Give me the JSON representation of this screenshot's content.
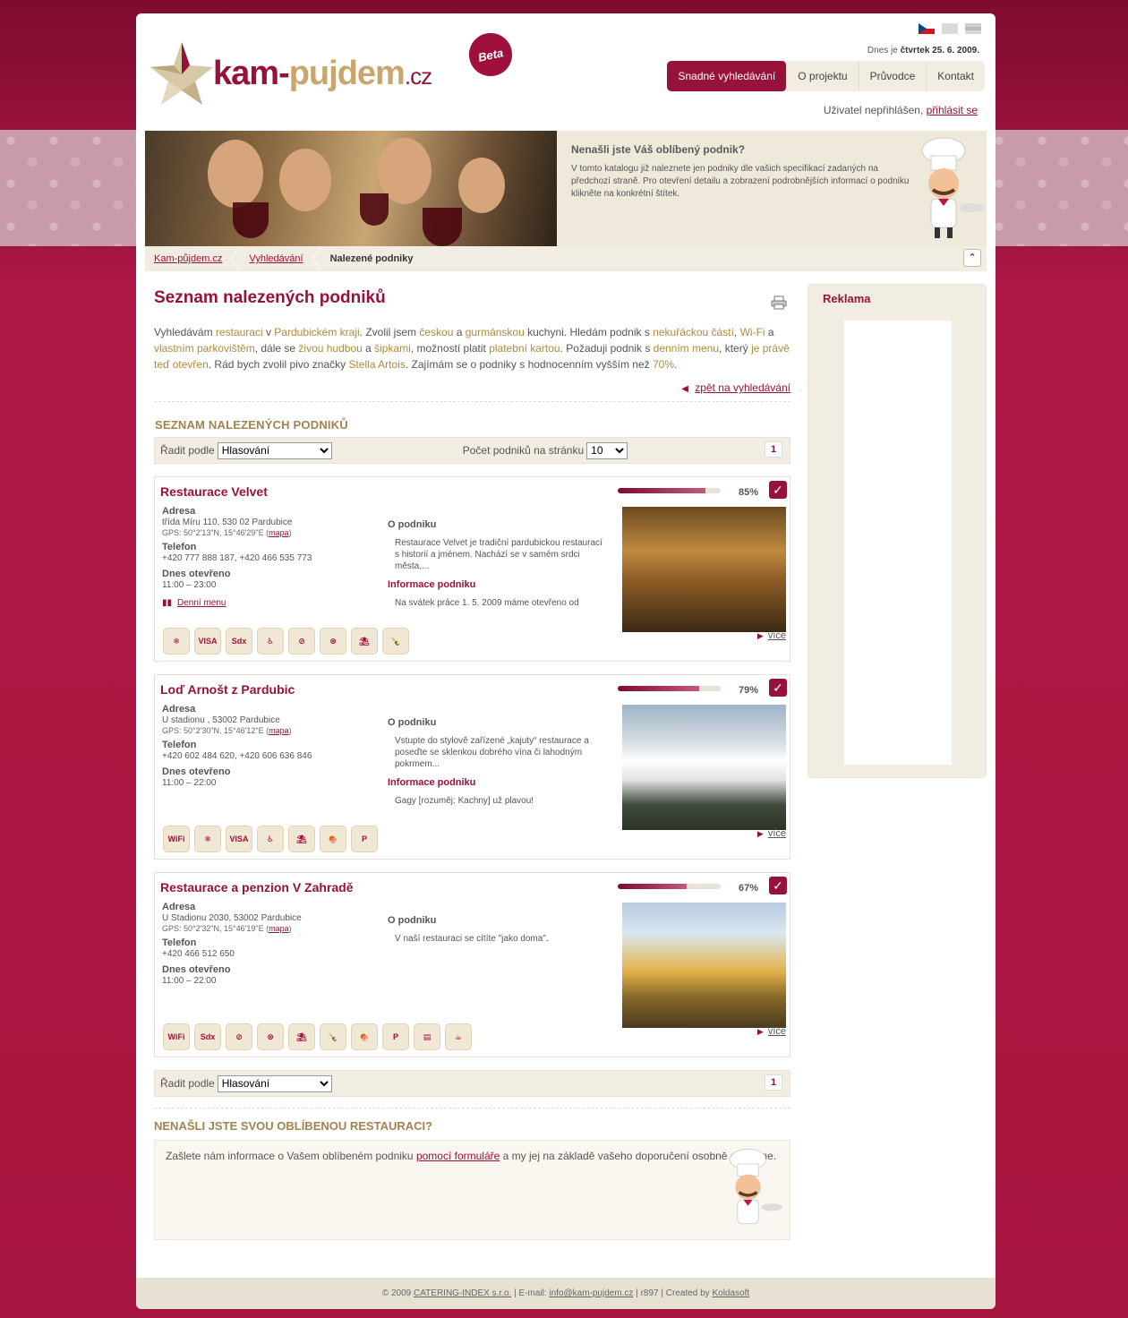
{
  "header": {
    "date_prefix": "Dnes je",
    "date_value": "čtvrtek 25. 6. 2009.",
    "logo": {
      "kam": "kam",
      "dash": "-",
      "pujdem": "pujdem",
      "cz": ".cz",
      "beta": "Beta"
    },
    "user_status": "Uživatel nepřihlášen,",
    "login_label": "přihlásit se"
  },
  "nav": {
    "items": [
      "Snadné vyhledávání",
      "O projektu",
      "Průvodce",
      "Kontakt"
    ],
    "active_index": 0
  },
  "banner": {
    "title": "Nenašli jste Váš oblíbený podnik?",
    "body": "V tomto katalogu již naleznete jen podniky dle vašich specifikací zadaných na předchozí straně. Pro otevření detailu a zobrazení podrobnějších informací o podniku klikněte na konkrétní štítek."
  },
  "breadcrumb": [
    "Kam-půjdem.cz",
    "Vyhledávání",
    "Nalezené podniky"
  ],
  "main": {
    "title": "Seznam nalezených podniků",
    "summary_parts": [
      {
        "t": "Vyhledávám ",
        "h": false
      },
      {
        "t": "restauraci",
        "h": true
      },
      {
        "t": " v ",
        "h": false
      },
      {
        "t": "Pardubickém kraji",
        "h": true
      },
      {
        "t": ". Zvolil jsem ",
        "h": false
      },
      {
        "t": "českou",
        "h": true
      },
      {
        "t": " a ",
        "h": false
      },
      {
        "t": "gurmánskou",
        "h": true
      },
      {
        "t": " kuchyni. Hledám podnik s ",
        "h": false
      },
      {
        "t": "nekuřáckou částí",
        "h": true
      },
      {
        "t": ", ",
        "h": false
      },
      {
        "t": "Wi-Fi",
        "h": true
      },
      {
        "t": " a ",
        "h": false
      },
      {
        "t": "vlastním parkovištěm",
        "h": true
      },
      {
        "t": ", dále se ",
        "h": false
      },
      {
        "t": "živou hudbou",
        "h": true
      },
      {
        "t": " a ",
        "h": false
      },
      {
        "t": "šipkami",
        "h": true
      },
      {
        "t": ", možností platit ",
        "h": false
      },
      {
        "t": "platební kartou",
        "h": true
      },
      {
        "t": ". Požaduji podnik s ",
        "h": false
      },
      {
        "t": "denním menu",
        "h": true
      },
      {
        "t": ", který ",
        "h": false
      },
      {
        "t": "je právě teď otevřen",
        "h": true
      },
      {
        "t": ". Rád bych zvolil pivo značky ",
        "h": false
      },
      {
        "t": "Stella Artois",
        "h": true
      },
      {
        "t": ". Zajímám se o podniky s hodnocenním vyšším než ",
        "h": false
      },
      {
        "t": "70%",
        "h": true
      },
      {
        "t": ".",
        "h": false
      }
    ],
    "back_link": "zpět na vyhledávání",
    "list_heading": "SEZNAM NALEZENÝCH PODNIKŮ",
    "sort_label": "Řadit podle",
    "sort_value": "Hlasování",
    "per_page_label": "Počet podniků na stránku",
    "per_page_value": "10",
    "page_number": "1",
    "labels": {
      "address": "Adresa",
      "phone": "Telefon",
      "open_today": "Dnes otevřeno",
      "about": "O podniku",
      "info": "Informace podniku",
      "map": "mapa",
      "daily_menu": "Denní menu",
      "more": "více"
    },
    "venues": [
      {
        "name": "Restaurace Velvet",
        "rating": 85,
        "rating_text": "85%",
        "address": "třída Míru 110, 530 02 Pardubice",
        "gps": "GPS: 50°2'13\"N, 15°46'29\"E",
        "phone": "+420 777 888 187, +420 466 535 773",
        "hours": "11:00 – 23:00",
        "has_menu": true,
        "about": "Restaurace Velvet je tradiční pardubickou restaurací s historií a jménem. Nachází se v samém srdci města,...",
        "info": "Na svátek práce 1. 5. 2009 máme otevřeno od",
        "features": [
          "snowflake-icon",
          "visa-icon",
          "sodexho-icon",
          "wheelchair-icon",
          "no-smoking-icon",
          "no-smoking-circle-icon",
          "terrace-icon",
          "bottle-icon"
        ]
      },
      {
        "name": "Loď Arnošt z Pardubic",
        "rating": 79,
        "rating_text": "79%",
        "address": "U stadionu , 53002 Pardubice",
        "gps": "GPS: 50°2'30\"N, 15°46'12\"E",
        "phone": "+420 602 484 620, +420 606 636 846",
        "hours": "11:00 – 22:00",
        "has_menu": false,
        "about": "Vstupte do stylově zařízené „kajuty“ restaurace a poseďte se sklenkou dobrého vína či lahodným pokrmem...",
        "info": "Gagy [rozuměj: Kachny] už plavou!",
        "features": [
          "wifi-icon",
          "snowflake-icon",
          "visa-icon",
          "wheelchair-icon",
          "terrace-icon",
          "meat-icon",
          "parking-icon"
        ]
      },
      {
        "name": "Restaurace a penzion V Zahradě",
        "rating": 67,
        "rating_text": "67%",
        "address": "U Stadionu 2030, 53002 Pardubice",
        "gps": "GPS: 50°2'32\"N, 15°46'19\"E",
        "phone": "+420 466 512 650",
        "hours": "11:00 – 22:00",
        "has_menu": false,
        "about": "V naší restauraci se cítíte \"jako doma\".",
        "info": "",
        "features": [
          "wifi-icon",
          "sodexho-icon",
          "no-smoking-icon",
          "no-smoking-circle-icon",
          "terrace-icon",
          "bottle-icon",
          "meat-icon",
          "parking-icon",
          "book-icon",
          "globe-cup-icon"
        ]
      }
    ],
    "fav_heading": "NENAŠLI JSTE SVOU OBLÍBENOU RESTAURACI?",
    "fav_text_before": "Zašlete nám informace o Vašem oblíbeném podniku ",
    "fav_link": "pomocí formuláře",
    "fav_text_after": " a my jej na základě vašeho doporučení osobně oslovíme."
  },
  "sidebar": {
    "title": "Reklama"
  },
  "footer": {
    "copyright": "© 2009",
    "company": "CATERING-INDEX s.r.o.",
    "email_label": "| E-mail:",
    "email": "info@kam-pujdem.cz",
    "revision": "| r897 | Created by",
    "author": "Koldasoft"
  },
  "colors": {
    "brand": "#97123b",
    "accent": "#b08a3c",
    "beige": "#f2ede2"
  }
}
